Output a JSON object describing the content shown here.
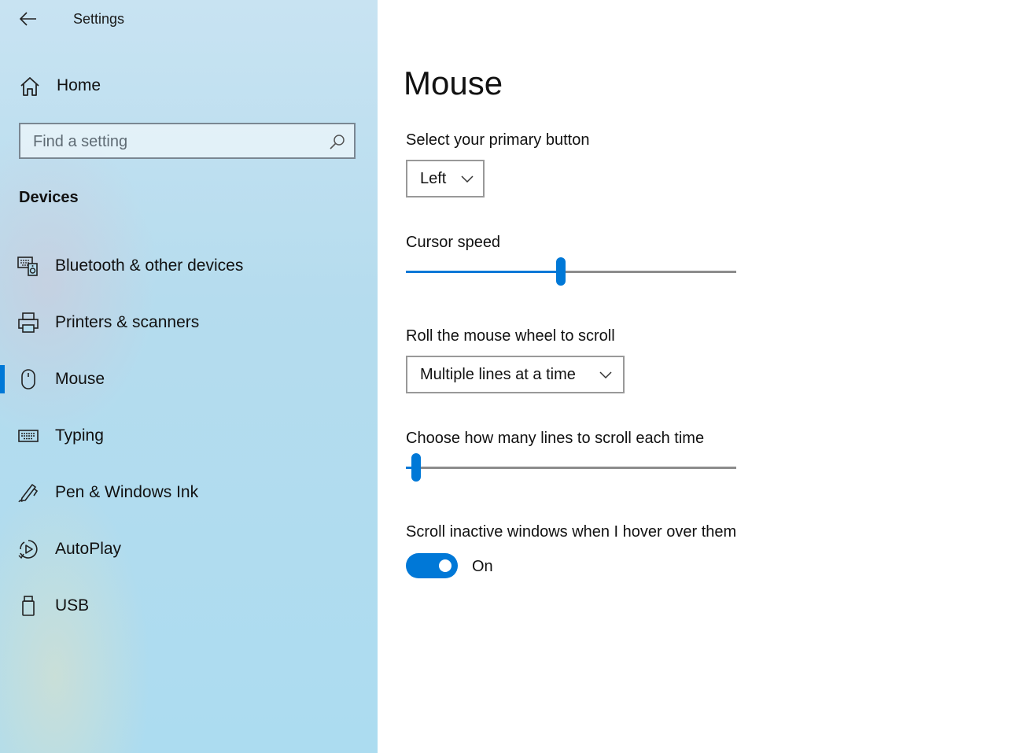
{
  "window": {
    "title": "Settings"
  },
  "sidebar": {
    "home_label": "Home",
    "search_placeholder": "Find a setting",
    "section_title": "Devices",
    "items": [
      {
        "label": "Bluetooth & other devices",
        "icon": "bluetooth-devices-icon"
      },
      {
        "label": "Printers & scanners",
        "icon": "printer-icon"
      },
      {
        "label": "Mouse",
        "icon": "mouse-icon",
        "active": true
      },
      {
        "label": "Typing",
        "icon": "keyboard-icon"
      },
      {
        "label": "Pen & Windows Ink",
        "icon": "pen-icon"
      },
      {
        "label": "AutoPlay",
        "icon": "autoplay-icon"
      },
      {
        "label": "USB",
        "icon": "usb-icon"
      }
    ]
  },
  "main": {
    "title": "Mouse",
    "primary_button": {
      "label": "Select your primary button",
      "value": "Left"
    },
    "cursor_speed": {
      "label": "Cursor speed",
      "level": 0.47
    },
    "wheel_scroll": {
      "label": "Roll the mouse wheel to scroll",
      "value": "Multiple lines at a time"
    },
    "lines_to_scroll": {
      "label": "Choose how many lines to scroll each time",
      "level": 0.03
    },
    "scroll_inactive": {
      "label": "Scroll inactive windows when I hover over them",
      "state": "On"
    }
  },
  "colors": {
    "accent": "#0078d7",
    "sidebar_bg": "#b5dcee"
  }
}
